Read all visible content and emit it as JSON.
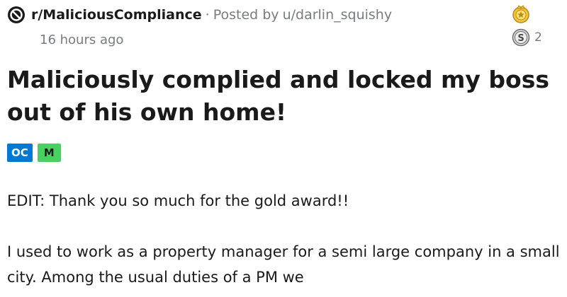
{
  "header": {
    "subreddit": "r/MaliciousCompliance",
    "separator": "·",
    "posted_by": "Posted by",
    "author": "u/darlin_squishy",
    "time": "16 hours ago"
  },
  "awards": {
    "gold_icon": "gold-award-icon",
    "silver_icon": "silver-award-icon",
    "silver_count": "2"
  },
  "post": {
    "title": "Maliciously complied and locked my boss out of his own home!",
    "flairs": [
      "OC",
      "M"
    ],
    "edit": "EDIT: Thank you so much for the gold award!!",
    "paragraph": "I used to work as a property manager for a semi large company in a small city. Among the usual duties of a PM we"
  },
  "colors": {
    "flair_oc": "#0079d3",
    "flair_m": "#46d160",
    "meta_gray": "#787c7e",
    "text": "#1a1a1b"
  }
}
